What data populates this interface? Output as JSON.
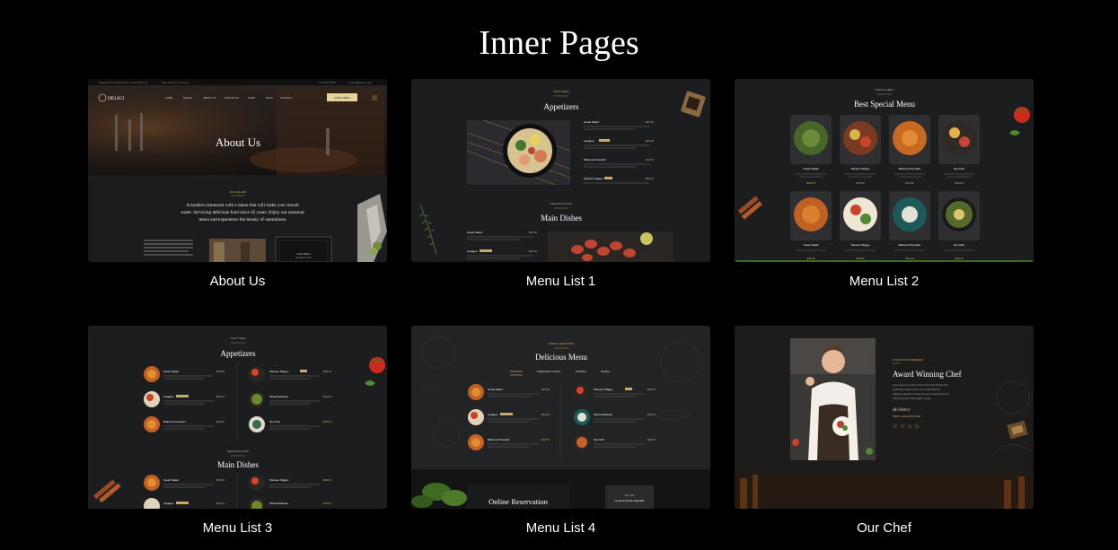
{
  "page": {
    "title": "Inner Pages"
  },
  "colors": {
    "background": "#000000",
    "gold": "#c9a96e",
    "card": "#1a1b1d"
  },
  "cards": [
    {
      "label": "About Us",
      "preview": {
        "brand": "DELICI",
        "nav": [
          "HOME",
          "PAGES",
          "ABOUT US",
          "PORTFOLIO",
          "SHOP",
          "BLOG",
          "CONTACT"
        ],
        "cta": "FIND A TABLE",
        "hero_heading": "About Us",
        "tagline": "WHO WE ARE",
        "lead": [
          "A modern restaurant with a menu that will make your mouth",
          "water. Servicing delicious food since 45 years. Enjoy our seasonal",
          "menu and experience the beauty of naturalness"
        ],
        "box_label": [
          "Lunch Menu",
          "Weekdays 12pm"
        ]
      }
    },
    {
      "label": "Menu List 1",
      "preview": {
        "kicker": "TASTY MENU",
        "heading_1": "Appetizers",
        "items_1": [
          {
            "name": "Greek Salad",
            "price": "$25.50"
          },
          {
            "name": "Lasagne",
            "price": "$40.00"
          },
          {
            "name": "Butternut Pumpkin",
            "price": "$10.00"
          },
          {
            "name": "Tokusen Wagyu",
            "price": "$39.00"
          }
        ],
        "kicker_2": "DELICIOUS FOOD",
        "heading_2": "Main Dishes",
        "items_2": [
          {
            "name": "Greek Salad",
            "price": "$25.50"
          },
          {
            "name": "Lasagne",
            "price": "$40.00"
          }
        ]
      }
    },
    {
      "label": "Menu List 2",
      "preview": {
        "kicker": "SPECIAL MENU",
        "heading": "Best Special Menu",
        "items": [
          {
            "name": "Greek Salad",
            "price": "$25.50"
          },
          {
            "name": "Tokusen Wagyu",
            "price": "$39.00"
          },
          {
            "name": "Butternut Pumpkin",
            "price": "$10.00"
          },
          {
            "name": "Opu Fish",
            "price": "$49.00"
          },
          {
            "name": "Greek Salad",
            "price": "$25.50"
          },
          {
            "name": "Tokusen Wagyu",
            "price": "$39.00"
          },
          {
            "name": "Butternut Pumpkin",
            "price": "$10.00"
          },
          {
            "name": "Opu Fish",
            "price": "$49.00"
          }
        ]
      }
    },
    {
      "label": "Menu List 3",
      "preview": {
        "kicker": "TASTY MENU",
        "heading_1": "Appetizers",
        "left": [
          {
            "name": "Greek Salad",
            "price": "$25.50"
          },
          {
            "name": "Lasagne",
            "price": "$40.00"
          },
          {
            "name": "Butternut Pumpkin",
            "price": "$10.00"
          }
        ],
        "right": [
          {
            "name": "Tokusen Wagyu",
            "price": "$39.00"
          },
          {
            "name": "Olivas Rellenas",
            "price": "$25.00"
          },
          {
            "name": "Opu Fish",
            "price": "$49.00"
          }
        ],
        "kicker_2": "DELICIOUS FOOD",
        "heading_2": "Main Dishes",
        "left_2": [
          {
            "name": "Greek Salad",
            "price": "$25.50"
          },
          {
            "name": "Lasagne",
            "price": "$40.00"
          }
        ],
        "right_2": [
          {
            "name": "Tokusen Wagyu",
            "price": "$39.00"
          },
          {
            "name": "Olivas Rellenas",
            "price": "$25.00"
          }
        ]
      }
    },
    {
      "label": "Menu List 4",
      "preview": {
        "kicker": "SPECIAL SELECTION",
        "heading": "Delicious Menu",
        "tabs": [
          "MORNING",
          "WEEKEND LUNCH",
          "DINNER",
          "WINES"
        ],
        "left": [
          {
            "name": "Greek Salad",
            "price": "$25.50"
          },
          {
            "name": "Lasagne",
            "price": "$40.00"
          },
          {
            "name": "Butternut Pumpkin",
            "price": "$10.00"
          }
        ],
        "right": [
          {
            "name": "Tokusen Wagyu",
            "price": "$39.00"
          },
          {
            "name": "Olivas Rellenas",
            "price": "$25.00"
          },
          {
            "name": "Opu Fish",
            "price": "$49.00"
          }
        ],
        "reservation": "Online Reservation",
        "promo_kicker": "GET 40%",
        "promo": "Lunch & Dinner Specials"
      }
    },
    {
      "label": "Our Chef",
      "preview": {
        "kicker": "25 YEARS OF EXPERIENCE",
        "heading": "Award Winning Chef",
        "body": [
          "Lorem ipsum is simply dummy text of the printing and",
          "typesetting industry lorem Ipsum has been the",
          "industry's standard dummy text ever since the when an",
          "unknown printer took a galley of type."
        ],
        "signature": "Ali Henry",
        "role": "HENRY - EXECUTIVE CHEF",
        "social": [
          "f",
          "t",
          "in",
          "y"
        ]
      }
    }
  ]
}
